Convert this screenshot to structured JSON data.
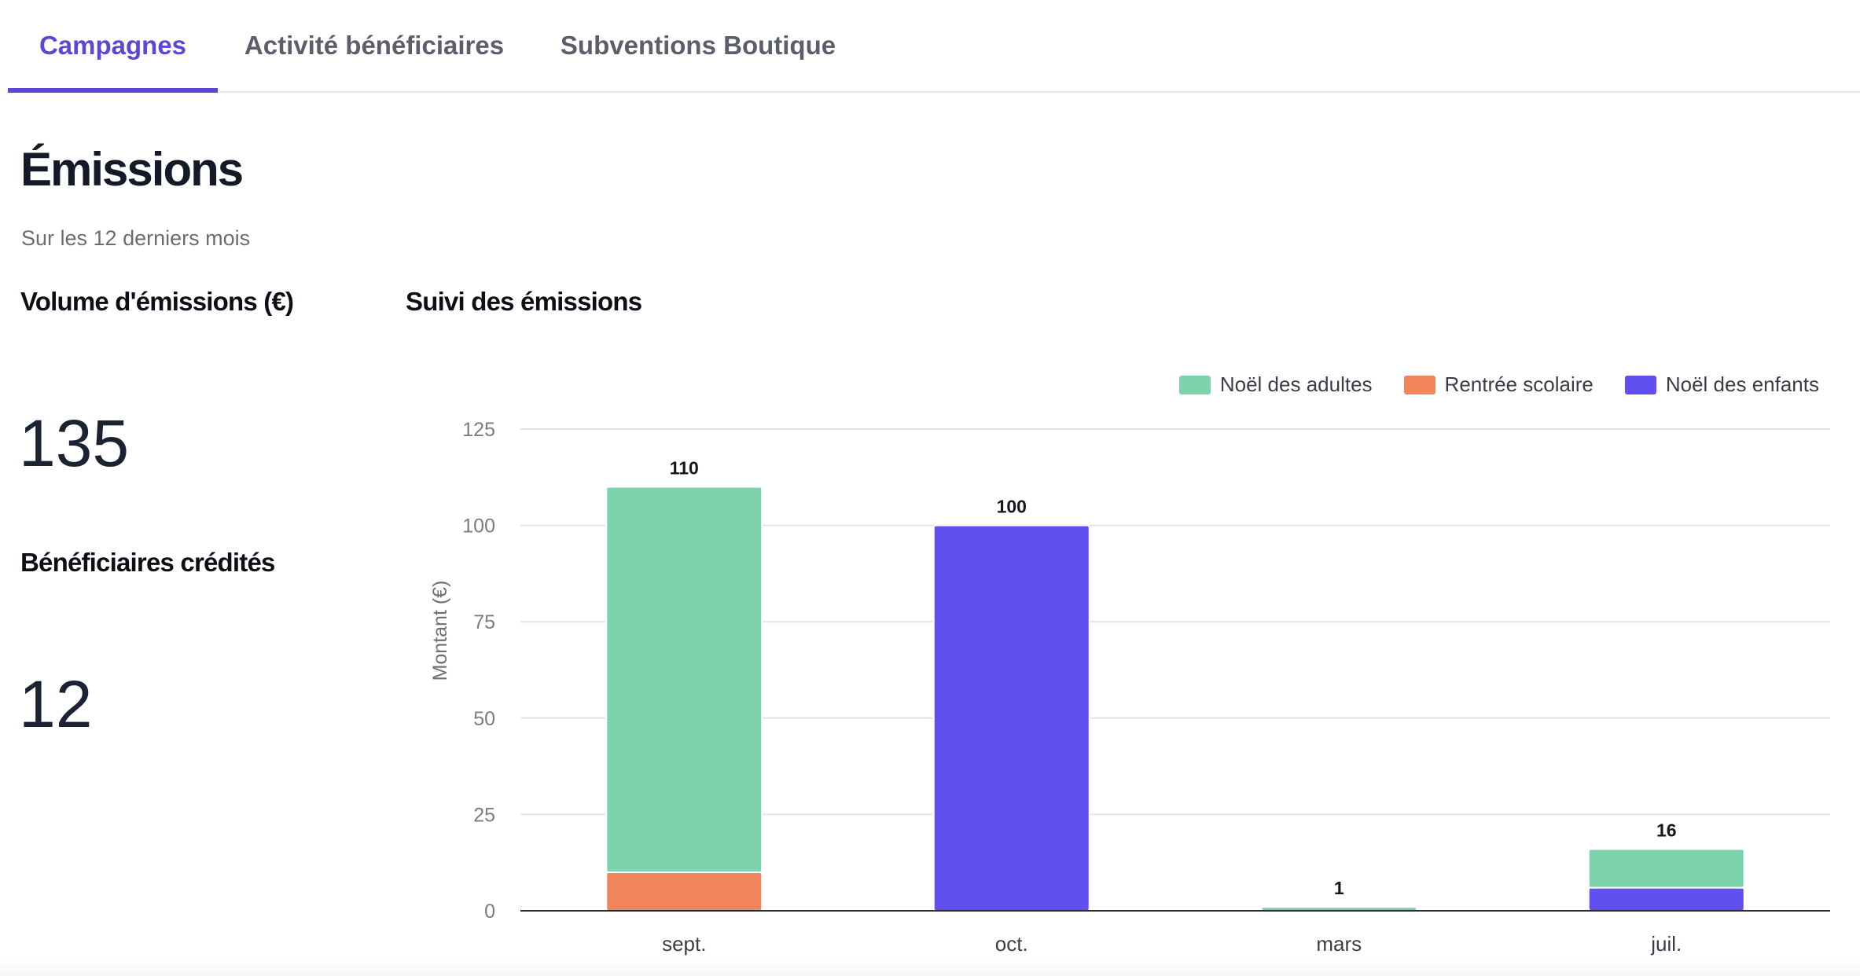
{
  "tabs": [
    {
      "label": "Campagnes",
      "active": true
    },
    {
      "label": "Activité bénéficiaires",
      "active": false
    },
    {
      "label": "Subventions Boutique",
      "active": false
    }
  ],
  "page": {
    "title": "Émissions",
    "subtitle": "Sur les 12 derniers mois"
  },
  "kpis": {
    "volume_label": "Volume d'émissions (€)",
    "volume_value": "135",
    "beneficiaries_label": "Bénéficiaires crédités",
    "beneficiaries_value": "12"
  },
  "chart_section": {
    "heading": "Suivi des émissions"
  },
  "chart_data": {
    "type": "bar",
    "stacked": true,
    "title": "",
    "xlabel": "",
    "ylabel": "Montant (€)",
    "ylim": [
      0,
      125
    ],
    "yticks": [
      0,
      25,
      50,
      75,
      100,
      125
    ],
    "grid": true,
    "legend_position": "top-right",
    "categories": [
      "sept.",
      "oct.",
      "mars",
      "juil."
    ],
    "series": [
      {
        "name": "Rentrée scolaire",
        "color": "#f0845a",
        "values": [
          10,
          0,
          0,
          0
        ]
      },
      {
        "name": "Noël des enfants",
        "color": "#624ff0",
        "values": [
          0,
          100,
          0,
          6
        ]
      },
      {
        "name": "Noël des adultes",
        "color": "#7dd4ac",
        "values": [
          100,
          0,
          1,
          10
        ]
      }
    ],
    "legend_order": [
      "Noël des adultes",
      "Rentrée scolaire",
      "Noël des enfants"
    ],
    "totals": [
      110,
      100,
      1,
      16
    ]
  }
}
